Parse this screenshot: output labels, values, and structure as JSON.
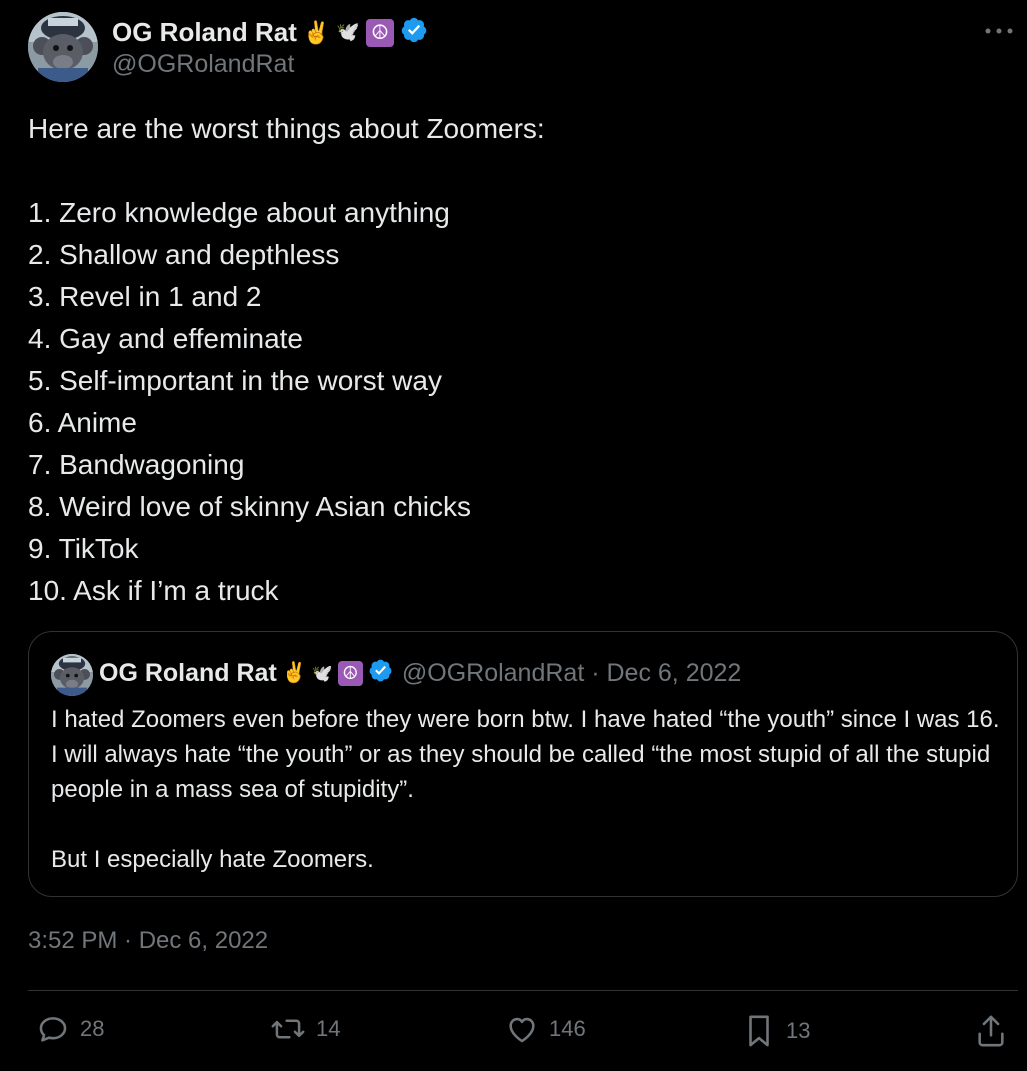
{
  "author": {
    "display_name": "OG Roland Rat",
    "handle": "@OGRolandRat",
    "name_emojis": {
      "victory": "✌️",
      "dove": "🕊️",
      "peace": "☮"
    },
    "verified_color": "#1d9bf0"
  },
  "tweet": {
    "intro": "Here are the worst things about Zoomers:",
    "list": [
      "1. Zero knowledge about anything",
      "2. Shallow and depthless",
      "3. Revel in 1 and 2",
      "4. Gay and effeminate",
      "5. Self-important in the worst way",
      "6. Anime",
      "7. Bandwagoning",
      "8. Weird love of skinny Asian chicks",
      "9. TikTok",
      "10. Ask if I’m a truck"
    ],
    "timestamp": "3:52 PM · Dec 6, 2022"
  },
  "quote": {
    "display_name": "OG Roland Rat",
    "meta": "@OGRolandRat · Dec 6, 2022",
    "paragraph1": "I hated Zoomers even before they were born btw. I have hated “the youth” since I was 16. I will always hate “the youth” or as they should be called “the most stupid of all the stupid people in a mass sea of stupidity”.",
    "paragraph2": "But I especially hate Zoomers."
  },
  "actions": {
    "replies": "28",
    "reposts": "14",
    "likes": "146",
    "bookmarks": "13"
  },
  "icons": {
    "more": "more-horizontal-icon",
    "reply": "reply-icon",
    "repost": "repost-icon",
    "like": "heart-icon",
    "bookmark": "bookmark-icon",
    "share": "share-icon",
    "verified": "verified-badge-icon"
  },
  "colors": {
    "background": "#000000",
    "text": "#e7e9ea",
    "secondary": "#71767b",
    "border": "#2f3336",
    "verified": "#1d9bf0",
    "peace_bg": "#9b59b6"
  }
}
